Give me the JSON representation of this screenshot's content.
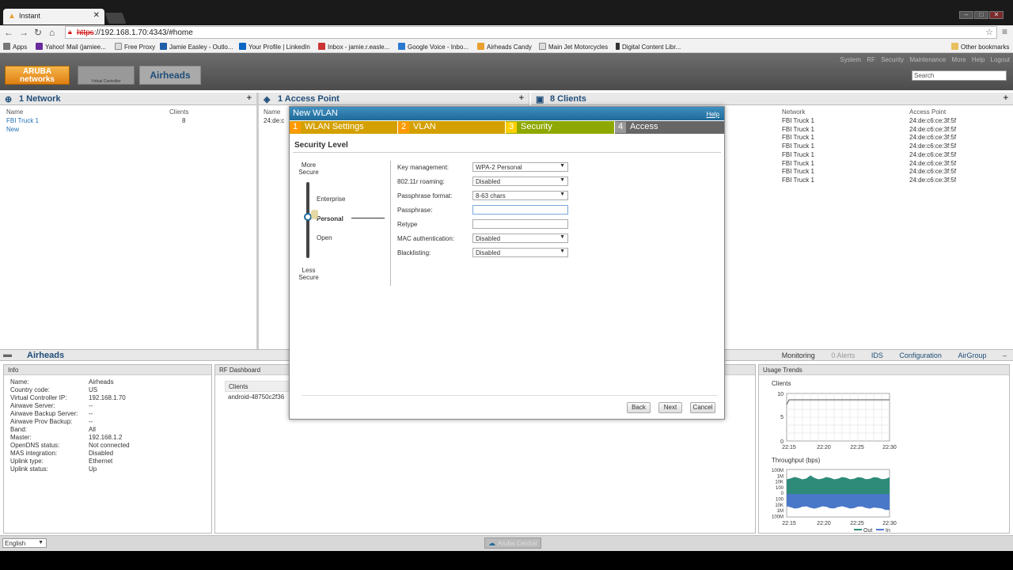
{
  "browser": {
    "tab_title": "Instant",
    "url_scheme": "https",
    "url_rest": "://192.168.1.70:4343/#home",
    "bookmarks": [
      "Apps",
      "Yahoo! Mail (jamiee...",
      "Free Proxy",
      "Jamie Easley - Outlo...",
      "Your Profile | LinkedIn",
      "Inbox - jamie.r.easle...",
      "Google Voice - Inbo...",
      "Airheads Candy",
      "Main Jet Motorcycles",
      "Digital Content Libr..."
    ],
    "other_bookmarks": "Other bookmarks"
  },
  "app": {
    "logo_text": "ARUBA networks",
    "controller_text": "Virtual Controller",
    "title": "Airheads",
    "top_links": [
      "System",
      "RF",
      "Security",
      "Maintenance",
      "More",
      "Help",
      "Logout"
    ],
    "search_placeholder": "Search"
  },
  "networks_panel": {
    "title": "1 Network",
    "col_name": "Name",
    "col_clients": "Clients",
    "rows": [
      {
        "name": "FBI Truck 1",
        "clients": "8"
      }
    ],
    "new_link": "New"
  },
  "ap_panel": {
    "title": "1 Access Point",
    "col_name": "Name",
    "row_name": "24:de:c"
  },
  "clients_panel": {
    "title": "8 Clients",
    "col_network": "Network",
    "col_ap": "Access Point",
    "rows": [
      {
        "network": "FBI Truck 1",
        "ap": "24:de:c6:ce:3f:5f"
      },
      {
        "network": "FBI Truck 1",
        "ap": "24:de:c6:ce:3f:5f"
      },
      {
        "network": "FBI Truck 1",
        "ap": "24:de:c6:ce:3f:5f"
      },
      {
        "network": "FBI Truck 1",
        "ap": "24:de:c6:ce:3f:5f"
      },
      {
        "network": "FBI Truck 1",
        "ap": "24:de:c6:ce:3f:5f"
      },
      {
        "network": "FBI Truck 1",
        "ap": "24:de:c6:ce:3f:5f"
      },
      {
        "network": "FBI Truck 1",
        "ap": "24:de:c6:ce:3f:5f"
      },
      {
        "network": "FBI Truck 1",
        "ap": "24:de:c6:ce:3f:5f"
      }
    ]
  },
  "airheads_bar": {
    "title": "Airheads",
    "links": [
      "Monitoring",
      "0 Alerts",
      "IDS",
      "Configuration",
      "AirGroup"
    ]
  },
  "info": {
    "header": "Info",
    "rows": [
      {
        "k": "Name:",
        "v": "Airheads"
      },
      {
        "k": "Country code:",
        "v": "US"
      },
      {
        "k": "Virtual Controller IP:",
        "v": "192.168.1.70"
      },
      {
        "k": "Airwave Server:",
        "v": "--"
      },
      {
        "k": "Airwave Backup Server:",
        "v": "--"
      },
      {
        "k": "Airwave Prov Backup:",
        "v": "--"
      },
      {
        "k": "Band:",
        "v": "All"
      },
      {
        "k": "Master:",
        "v": "192.168.1.2"
      },
      {
        "k": "OpenDNS status:",
        "v": "Not connected"
      },
      {
        "k": "MAS integration:",
        "v": "Disabled"
      },
      {
        "k": "Uplink type:",
        "v": "Ethernet"
      },
      {
        "k": "Uplink status:",
        "v": "Up"
      }
    ]
  },
  "rf_dashboard": {
    "header": "RF Dashboard",
    "clients_label": "Clients",
    "client_row": "android-48750c2f36"
  },
  "usage": {
    "header": "Usage Trends",
    "clients_label": "Clients",
    "throughput_label": "Throughput (bps)",
    "clients_y": [
      "10",
      "5",
      "0"
    ],
    "throughput_y": [
      "100M",
      "1M",
      "10K",
      "100",
      "0",
      "100",
      "10K",
      "1M",
      "100M"
    ],
    "x_ticks": [
      "22:15",
      "22:20",
      "22:25",
      "22:30"
    ],
    "legend_out": "Out",
    "legend_in": "In",
    "colors": {
      "out": "#2e8b7a",
      "in": "#4a78c8"
    }
  },
  "footer": {
    "language": "English",
    "central": "Aruba Central"
  },
  "modal": {
    "title": "New WLAN",
    "help": "Help",
    "steps": [
      {
        "num": "1",
        "label": "WLAN Settings",
        "bg": "#d4a000",
        "numbg": "#ff9a00"
      },
      {
        "num": "2",
        "label": "VLAN",
        "bg": "#d4a000",
        "numbg": "#ff9a00"
      },
      {
        "num": "3",
        "label": "Security",
        "bg": "#8fa800",
        "numbg": "#ffd000"
      },
      {
        "num": "4",
        "label": "Access",
        "bg": "#666666",
        "numbg": "#999999"
      }
    ],
    "section_title": "Security Level",
    "more_secure": "More Secure",
    "less_secure": "Less Secure",
    "levels": [
      "Enterprise",
      "Personal",
      "Open"
    ],
    "selected_level": "Personal",
    "fields": [
      {
        "label": "Key management:",
        "value": "WPA-2 Personal",
        "type": "select"
      },
      {
        "label": "802.11r roaming:",
        "value": "Disabled",
        "type": "select"
      },
      {
        "label": "Passphrase format:",
        "value": "8-63 chars",
        "type": "select"
      },
      {
        "label": "Passphrase:",
        "value": "",
        "type": "input"
      },
      {
        "label": "Retype",
        "value": "",
        "type": "input"
      },
      {
        "label": "MAC authentication:",
        "value": "Disabled",
        "type": "select"
      },
      {
        "label": "Blacklisting:",
        "value": "Disabled",
        "type": "select"
      }
    ],
    "buttons": {
      "back": "Back",
      "next": "Next",
      "cancel": "Cancel"
    }
  }
}
